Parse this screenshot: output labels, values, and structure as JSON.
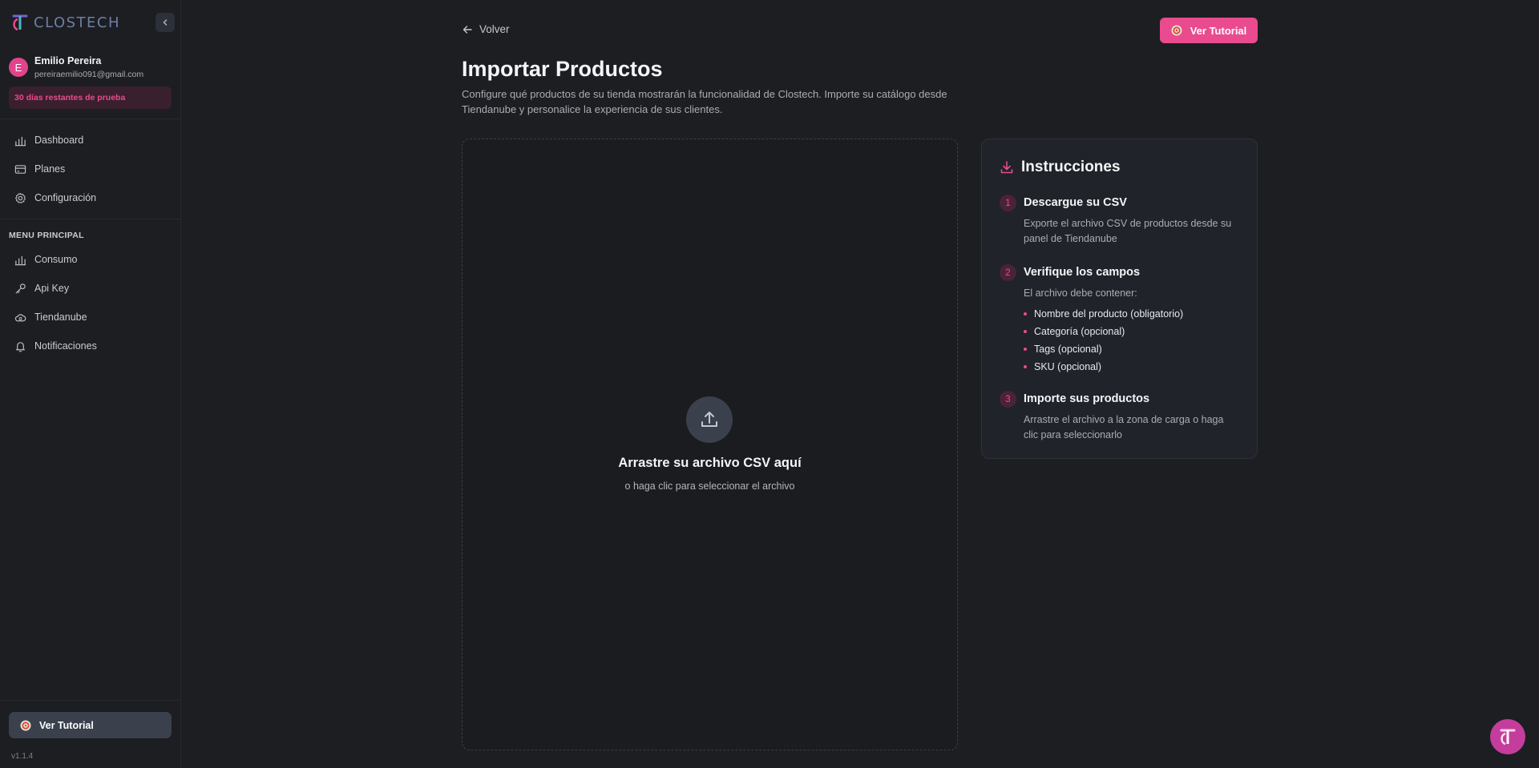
{
  "brand": {
    "name": "CLOSTECH"
  },
  "user": {
    "initial": "E",
    "name": "Emilio Pereira",
    "email": "pereiraemilio091@gmail.com",
    "trial_badge": "30 días restantes de prueba"
  },
  "sidebar": {
    "top_items": [
      {
        "label": "Dashboard",
        "icon": "bar-chart-icon"
      },
      {
        "label": "Planes",
        "icon": "credit-card-icon"
      },
      {
        "label": "Configuración",
        "icon": "gear-icon"
      }
    ],
    "section_title": "MENU PRINCIPAL",
    "main_items": [
      {
        "label": "Consumo",
        "icon": "bar-chart-icon"
      },
      {
        "label": "Api Key",
        "icon": "key-icon"
      },
      {
        "label": "Tiendanube",
        "icon": "cloud-icon"
      },
      {
        "label": "Notificaciones",
        "icon": "bell-icon"
      }
    ],
    "tutorial_button": "Ver Tutorial",
    "version": "v1.1.4"
  },
  "header": {
    "back_label": "Volver",
    "tutorial_button": "Ver Tutorial"
  },
  "page": {
    "title": "Importar Productos",
    "description": "Configure qué productos de su tienda mostrarán la funcionalidad de Clostech. Importe su catálogo desde Tiendanube y personalice la experiencia de sus clientes."
  },
  "dropzone": {
    "title": "Arrastre su archivo CSV aquí",
    "subtitle": "o haga clic para seleccionar el archivo"
  },
  "instructions": {
    "title": "Instrucciones",
    "steps": [
      {
        "number": "1",
        "title": "Descargue su CSV",
        "text": "Exporte el archivo CSV de productos desde su panel de Tiendanube"
      },
      {
        "number": "2",
        "title": "Verifique los campos",
        "text": "El archivo debe contener:",
        "bullets": [
          "Nombre del producto (obligatorio)",
          "Categoría (opcional)",
          "Tags (opcional)",
          "SKU (opcional)"
        ]
      },
      {
        "number": "3",
        "title": "Importe sus productos",
        "text": "Arrastre el archivo a la zona de carga o haga clic para seleccionarlo"
      }
    ]
  },
  "colors": {
    "accent": "#e94b8e",
    "background": "#1c1e22",
    "card": "#20232a",
    "fab": "#c43d9c"
  }
}
